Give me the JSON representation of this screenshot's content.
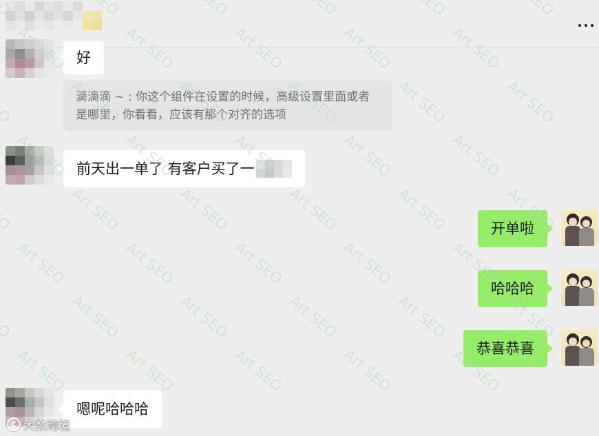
{
  "header": {
    "more_icon": "more-icon"
  },
  "colors": {
    "background": "#eeeeee",
    "bubble_incoming": "#ffffff",
    "bubble_outgoing": "#95ec69",
    "quote_background": "#e4e4e4",
    "quote_text": "#6e6e6e",
    "watermark": "#b6dcbc"
  },
  "messages": [
    {
      "incoming": true,
      "text": "好"
    },
    {
      "incoming": true,
      "quote": "滴滴滴 ~ : 你这个组件在设置的时候，高级设置里面或者是哪里，你看看，应该有那个对齐的选项"
    },
    {
      "incoming": true,
      "text": "前天出一单了 有客户买了一"
    },
    {
      "incoming": false,
      "text": "开单啦"
    },
    {
      "incoming": false,
      "text": "哈哈哈"
    },
    {
      "incoming": false,
      "text": "恭喜恭喜"
    },
    {
      "incoming": true,
      "text": "嗯呢哈哈哈"
    }
  ],
  "watermark": {
    "text": "Art SEO"
  },
  "brand_watermark": {
    "text": "大数跨境",
    "icon": "brand-logo-icon"
  }
}
